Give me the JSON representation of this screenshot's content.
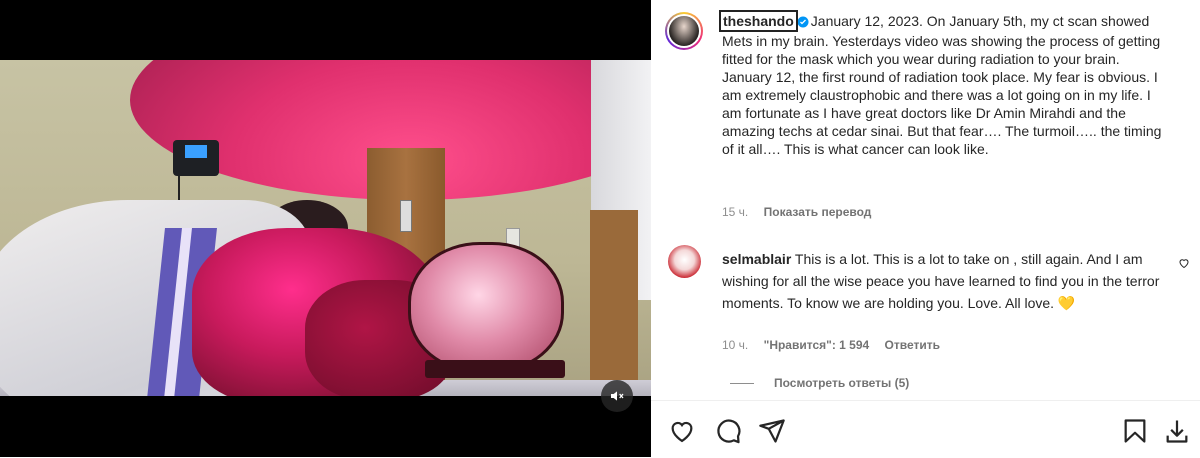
{
  "post": {
    "username": "theshando",
    "caption": "January 12, 2023. On January 5th, my ct scan showed Mets in my brain. Yesterdays video was showing the process of getting fitted for the mask which you wear during radiation to your brain. January 12, the first round of radiation took place. My fear is obvious. I am extremely claustrophobic and there was a lot going on in my life. I am fortunate as I have great doctors like Dr Amin Mirahdi and the amazing techs at cedar sinai. But that fear…. The turmoil….. the timing of it all…. This is what cancer can look like.",
    "time": "15 ч.",
    "translate_label": "Показать перевод"
  },
  "comment": {
    "username": "selmablair",
    "text": "This is a lot. This is a lot to take on , still again. And I am wishing for all the wise peace you have learned to find you in the terror moments. To know we are holding you. Love. All love. 💛",
    "time": "10 ч.",
    "likes": "\"Нравится\": 1 594",
    "reply_label": "Ответить",
    "view_replies": "Посмотреть ответы (5)"
  },
  "icons": {
    "mute": "speaker-muted-icon",
    "verified": "verified-badge-icon",
    "like": "heart-icon",
    "comment": "comment-icon",
    "share": "share-icon",
    "save": "bookmark-icon",
    "download": "download-icon"
  },
  "colors": {
    "verified": "#0095f6",
    "muted_text": "#737373"
  }
}
